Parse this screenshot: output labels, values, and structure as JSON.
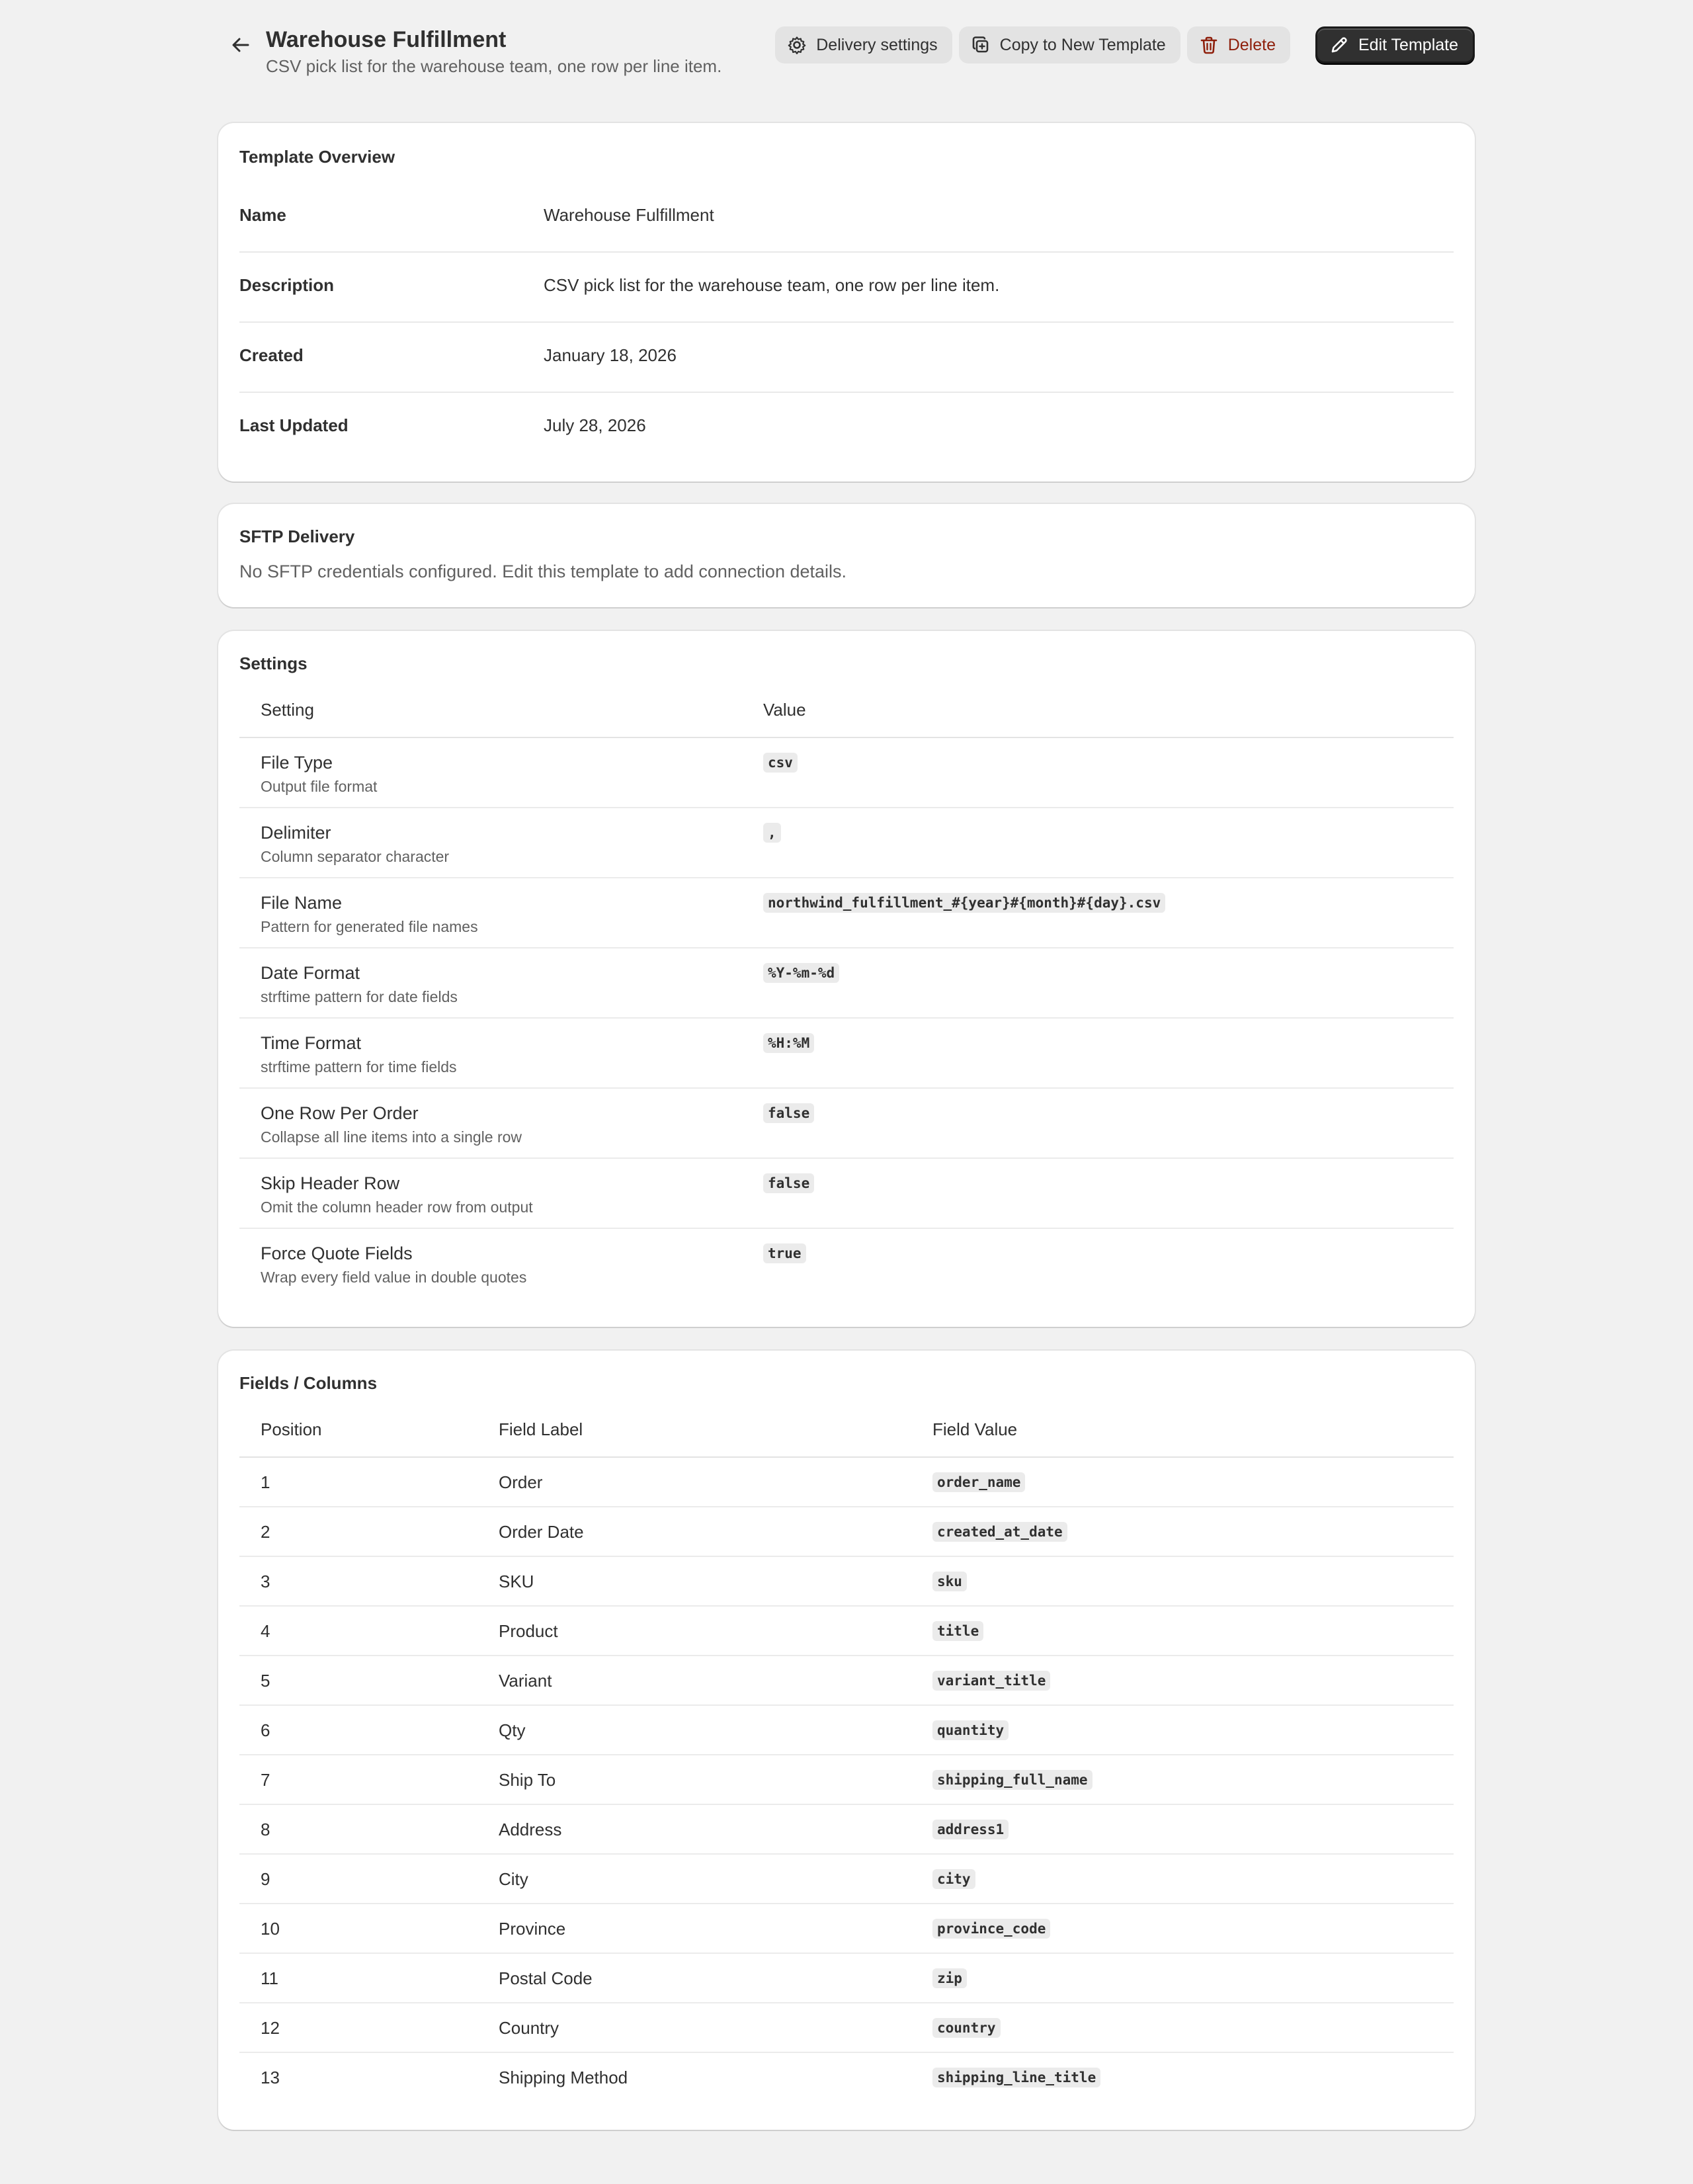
{
  "header": {
    "title": "Warehouse Fulfillment",
    "subtitle": "CSV pick list for the warehouse team, one row per line item.",
    "actions": {
      "delivery_settings": "Delivery settings",
      "copy_template": "Copy to New Template",
      "delete": "Delete",
      "edit_template": "Edit Template"
    }
  },
  "overview": {
    "title": "Template Overview",
    "rows": [
      {
        "label": "Name",
        "value": "Warehouse Fulfillment"
      },
      {
        "label": "Description",
        "value": "CSV pick list for the warehouse team, one row per line item."
      },
      {
        "label": "Created",
        "value": "January 18, 2026"
      },
      {
        "label": "Last Updated",
        "value": "July 28, 2026"
      }
    ]
  },
  "sftp": {
    "title": "SFTP Delivery",
    "message": "No SFTP credentials configured. Edit this template to add connection details."
  },
  "settings": {
    "title": "Settings",
    "columns": {
      "setting": "Setting",
      "value": "Value"
    },
    "rows": [
      {
        "name": "File Type",
        "desc": "Output file format",
        "value": "csv"
      },
      {
        "name": "Delimiter",
        "desc": "Column separator character",
        "value": ","
      },
      {
        "name": "File Name",
        "desc": "Pattern for generated file names",
        "value": "northwind_fulfillment_#{year}#{month}#{day}.csv"
      },
      {
        "name": "Date Format",
        "desc": "strftime pattern for date fields",
        "value": "%Y-%m-%d"
      },
      {
        "name": "Time Format",
        "desc": "strftime pattern for time fields",
        "value": "%H:%M"
      },
      {
        "name": "One Row Per Order",
        "desc": "Collapse all line items into a single row",
        "value": "false"
      },
      {
        "name": "Skip Header Row",
        "desc": "Omit the column header row from output",
        "value": "false"
      },
      {
        "name": "Force Quote Fields",
        "desc": "Wrap every field value in double quotes",
        "value": "true"
      }
    ]
  },
  "fields": {
    "title": "Fields / Columns",
    "columns": {
      "position": "Position",
      "label": "Field Label",
      "value": "Field Value"
    },
    "rows": [
      {
        "position": "1",
        "label": "Order",
        "value": "order_name"
      },
      {
        "position": "2",
        "label": "Order Date",
        "value": "created_at_date"
      },
      {
        "position": "3",
        "label": "SKU",
        "value": "sku"
      },
      {
        "position": "4",
        "label": "Product",
        "value": "title"
      },
      {
        "position": "5",
        "label": "Variant",
        "value": "variant_title"
      },
      {
        "position": "6",
        "label": "Qty",
        "value": "quantity"
      },
      {
        "position": "7",
        "label": "Ship To",
        "value": "shipping_full_name"
      },
      {
        "position": "8",
        "label": "Address",
        "value": "address1"
      },
      {
        "position": "9",
        "label": "City",
        "value": "city"
      },
      {
        "position": "10",
        "label": "Province",
        "value": "province_code"
      },
      {
        "position": "11",
        "label": "Postal Code",
        "value": "zip"
      },
      {
        "position": "12",
        "label": "Country",
        "value": "country"
      },
      {
        "position": "13",
        "label": "Shipping Method",
        "value": "shipping_line_title"
      }
    ]
  },
  "icons": {
    "back": "arrow-left-icon",
    "delivery_settings": "gear-icon",
    "copy_template": "copy-icon",
    "delete": "trash-icon",
    "edit_template": "pencil-icon"
  },
  "colors": {
    "page_bg": "#f1f1f1",
    "card_bg": "#ffffff",
    "primary_button": "#303030",
    "danger_text": "#8e1f0b"
  }
}
